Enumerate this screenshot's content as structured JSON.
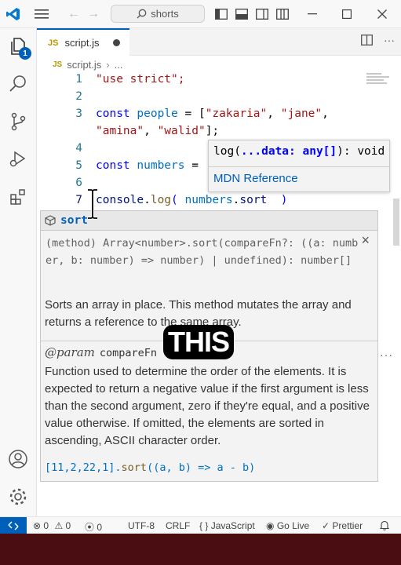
{
  "titlebar": {
    "search_text": "shorts"
  },
  "tab": {
    "filename": "script.js",
    "lang_badge": "JS"
  },
  "breadcrumb": {
    "file": "script.js",
    "more": "..."
  },
  "editor": {
    "line_numbers": [
      "1",
      "2",
      "3",
      "4",
      "5",
      "6",
      "7"
    ],
    "line1": "\"use strict\";",
    "line3_kw": "const",
    "line3_name": "people",
    "line3_eq": " = [",
    "line3_s1": "\"zakaria\"",
    "line3_c1": ", ",
    "line3_s2": "\"jane\"",
    "line3_c2": ",",
    "line3b_s3": "\"amina\"",
    "line3b_c3": ", ",
    "line3b_s4": "\"walid\"",
    "line3b_end": "];",
    "line5_kw": "const",
    "line5_name": "numbers",
    "line5_eq": " = [",
    "line7_obj": "console",
    "line7_dot": ".",
    "line7_fn": "log",
    "line7_open": "( ",
    "line7_arg": "numbers",
    "line7_dot2": ".",
    "line7_prop": "sort",
    "line7_close": "  )"
  },
  "signature": {
    "prefix": "log(",
    "param": "...data: any[]",
    "suffix": "): void",
    "link": "MDN Reference"
  },
  "suggest": {
    "label": "sort"
  },
  "detail": {
    "signature": "(method) Array<number>.sort(compareFn?: ((a: number, b: number) => number) | undefined): number[]",
    "close": "×",
    "description": "Sorts an array in place. This method mutates the array and returns a reference to the same array.",
    "param_tag": "@param",
    "param_name": "compareFn",
    "param_desc": "Function used to determine the order of the elements. It is expected to return a negative value if the first argument is less than the second argument, zero if they're equal, and a positive value otherwise. If omitted, the elements are sorted in ascending, ASCII character order.",
    "example_arr": "[11,2,22,1]",
    "example_dot": ".",
    "example_fn": "sort",
    "example_rest": "((a, b) => a - b)"
  },
  "caption": "THIS",
  "statusbar": {
    "errors": "0",
    "warnings": "0",
    "ports": "0",
    "encoding": "UTF-8",
    "eol": "CRLF",
    "braces": "{ }",
    "language": "JavaScript",
    "golive": "Go Live",
    "prettier": "Prettier"
  },
  "badges": {
    "explorer_count": "1"
  },
  "colors": {
    "accent": "#005fb8",
    "bottom_bar": "#4a0d12"
  }
}
